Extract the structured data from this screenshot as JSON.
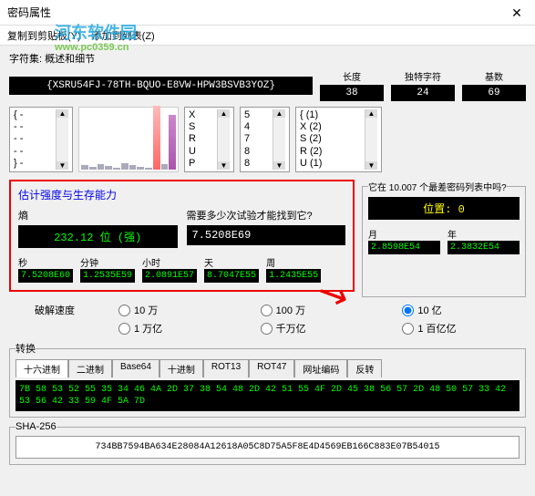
{
  "window": {
    "title": "密码属性",
    "close": "✕"
  },
  "menu": {
    "copy": "复制到剪贴板(Y)",
    "add": "添加到列表(Z)"
  },
  "watermark": {
    "main": "河东软件园",
    "sub": "www.pc0359.cn"
  },
  "charset_label": "字符集: 概述和细节",
  "password": "{XSRU54FJ-78TH-BQUO-E8VW-HPW3BSVB3YOZ}",
  "stats": {
    "len": {
      "hdr": "长度",
      "val": "38"
    },
    "uniq": {
      "hdr": "独特字符",
      "val": "24"
    },
    "base": {
      "hdr": "基数",
      "val": "69"
    }
  },
  "cols": {
    "c1": "{ -\n- -\n- -\n- -\n} -",
    "c2": "X\nS\nR\nU\nP",
    "c3": "5\n4\n7\n8\n8",
    "c4": "{ (1)\nX (2)\nS (2)\nR (2)\nU (1)"
  },
  "chart_data": {
    "type": "bar",
    "values": [
      5,
      3,
      6,
      4,
      2,
      7,
      5,
      3,
      2,
      70,
      6,
      60
    ],
    "highlights": [
      9,
      11
    ]
  },
  "red": {
    "heading": "估计强度与生存能力",
    "entropy_label": "熵",
    "entropy_val": "232.12 位 (强)",
    "trials_label": "需要多少次试验才能找到它?",
    "trials_val": "7.5208E69",
    "rank_legend": "它在 10.007 个最差密码列表中吗?",
    "rank_val": "位置: 0"
  },
  "times": {
    "sec": {
      "lbl": "秒",
      "val": "7.5208E60"
    },
    "min": {
      "lbl": "分钟",
      "val": "1.2535E59"
    },
    "hr": {
      "lbl": "小时",
      "val": "2.0891E57"
    },
    "day": {
      "lbl": "天",
      "val": "8.7047E55"
    },
    "wk": {
      "lbl": "周",
      "val": "1.2435E55"
    },
    "mon": {
      "lbl": "月",
      "val": "2.8598E54"
    },
    "yr": {
      "lbl": "年",
      "val": "2.3832E54"
    }
  },
  "crack": {
    "label": "破解速度",
    "opts": [
      "10 万",
      "100 万",
      "10 亿",
      "1 万亿",
      "千万亿",
      "1 百亿亿"
    ]
  },
  "convert": {
    "legend": "转换",
    "tabs": [
      "十六进制",
      "二进制",
      "Base64",
      "十进制",
      "ROT13",
      "ROT47",
      "网址编码",
      "反转"
    ],
    "hex": "7B 58 53 52 55 35 34 46 4A 2D 37 38 54 48 2D 42 51 55 4F 2D 45 38 56 57 2D 48 50 57 33 42 53 56 42 33 59 4F 5A 7D"
  },
  "sha": {
    "legend": "SHA-256",
    "val": "734BB7594BA634E28084A12618A05C8D75A5F8E4D4569EB166C883E07B54015"
  }
}
